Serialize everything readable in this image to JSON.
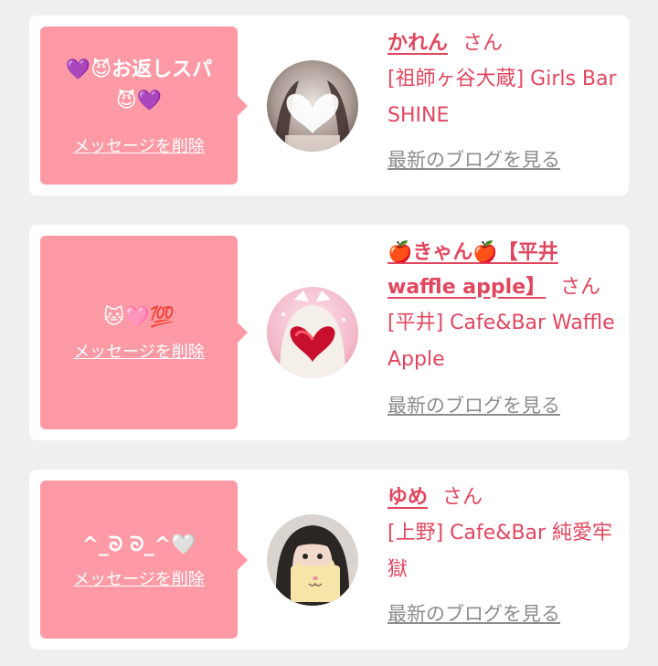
{
  "colors": {
    "background": "#efefef",
    "card": "#ffffff",
    "bubble": "#fd9aa5",
    "accent": "#e0475f",
    "link_gray": "#8c8c8c"
  },
  "delete_label": "メッセージを削除",
  "blog_label": "最新のブログを見る",
  "honorific": "さん",
  "cards": [
    {
      "message": "💜😈お返しスパ😈💜",
      "name": "かれん",
      "shop": "[祖師ヶ谷大蔵] Girls Bar SHINE",
      "avatar_icon": "heart-face-photo"
    },
    {
      "message": "🐱🩷💯",
      "name": "🍎きゃん🍎【平井waffle apple】",
      "shop": "[平井] Cafe&Bar Waffle Apple",
      "avatar_icon": "red-heart-face-photo"
    },
    {
      "message": "^_ᘐ ᘐ_^🤍",
      "name": "ゆめ",
      "shop": "[上野] Cafe&Bar 純愛牢獄",
      "avatar_icon": "cat-mask-face-photo"
    }
  ]
}
